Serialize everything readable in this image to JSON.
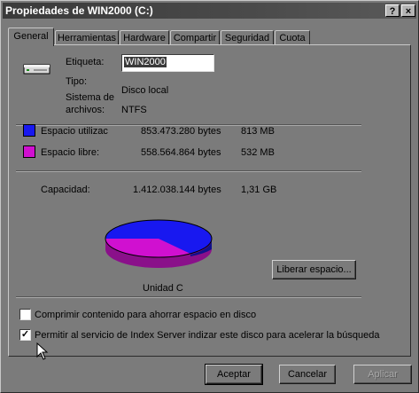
{
  "window": {
    "title": "Propiedades de WIN2000 (C:)"
  },
  "titlebar_buttons": {
    "help": "?",
    "close": "×"
  },
  "tabs": [
    "General",
    "Herramientas",
    "Hardware",
    "Compartir",
    "Seguridad",
    "Cuota"
  ],
  "general": {
    "label_caption": "Etiqueta:",
    "label_value": "WIN2000",
    "type_caption": "Tipo:",
    "type_value": "Disco local",
    "fs_caption_line1": "Sistema de",
    "fs_caption_line2": "archivos:",
    "fs_value": "NTFS",
    "used": {
      "label": "Espacio utilizac",
      "bytes": "853.473.280 bytes",
      "size": "813 MB",
      "color": "#1818f0"
    },
    "free": {
      "label": "Espacio libre:",
      "bytes": "558.564.864 bytes",
      "size": "532 MB",
      "color": "#d010d0"
    },
    "capacity": {
      "label": "Capacidad:",
      "bytes": "1.412.038.144 bytes",
      "size": "1,31 GB"
    },
    "drive_label": "Unidad C",
    "cleanup_button": "Liberar espacio...",
    "compress_label": "Comprimir contenido para ahorrar espacio en disco",
    "compress_checked": false,
    "index_label": "Permitir al servicio de Index Server indizar este disco para acelerar la búsqueda",
    "index_checked": true
  },
  "footer": {
    "ok": "Aceptar",
    "cancel": "Cancelar",
    "apply": "Aplicar"
  },
  "icons": {
    "drive": "hard-drive-icon",
    "cursor": "mouse-cursor-icon"
  }
}
